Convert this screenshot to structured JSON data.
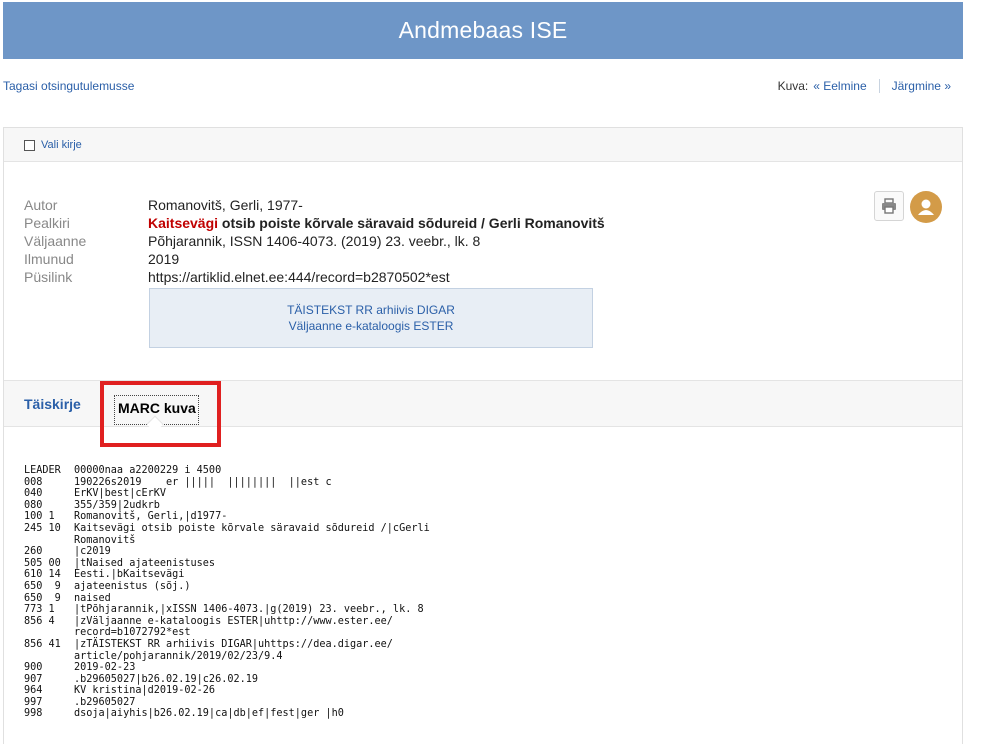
{
  "header": {
    "title": "Andmebaas ISE"
  },
  "nav": {
    "back_label": "Tagasi otsingutulemusse",
    "view_label": "Kuva:",
    "prev_label": "« Eelmine",
    "next_label": "Järgmine »"
  },
  "select": {
    "label": "Vali kirje"
  },
  "record": {
    "author_key": "Autor",
    "author_value": "Romanovitš, Gerli, 1977-",
    "title_key": "Pealkiri",
    "title_highlight": "Kaitsevägi",
    "title_rest": " otsib poiste kõrvale säravaid sõdureid / Gerli Romanovitš",
    "source_key": "Väljaanne",
    "source_value": "Põhjarannik, ISSN 1406-4073. (2019) 23. veebr., lk. 8",
    "published_key": "Ilmunud",
    "published_value": "2019",
    "permalink_key": "Püsilink",
    "permalink_value": "https://artiklid.elnet.ee:444/record=b2870502*est"
  },
  "links": {
    "fulltext": "TÄISTEKST RR arhiivis DIGAR",
    "catalog": "Väljaanne e-kataloogis ESTER"
  },
  "icons": {
    "print": "printer-icon",
    "user": "user-icon"
  },
  "tabs": {
    "full": "Täiskirje",
    "marc": "MARC kuva"
  },
  "marc": [
    {
      "tag": "LEADER",
      "text": "00000naa a2200229 i 4500"
    },
    {
      "tag": "008",
      "text": "190226s2019    er |||||  ||||||||  ||est c"
    },
    {
      "tag": "040",
      "text": "ErKV|best|cErKV"
    },
    {
      "tag": "080",
      "text": "355/359|2udkrb"
    },
    {
      "tag": "100 1",
      "text": "Romanovitš, Gerli,|d1977-"
    },
    {
      "tag": "245 10",
      "text": "Kaitsevägi otsib poiste kõrvale säravaid sõdureid /|cGerli"
    },
    {
      "tag": "",
      "text": "Romanovitš"
    },
    {
      "tag": "260",
      "text": "|c2019"
    },
    {
      "tag": "505 00",
      "text": "|tNaised ajateenistuses"
    },
    {
      "tag": "610 14",
      "text": "Eesti.|bKaitsevägi"
    },
    {
      "tag": "650  9",
      "text": "ajateenistus (sõj.)"
    },
    {
      "tag": "650  9",
      "text": "naised"
    },
    {
      "tag": "773 1",
      "text": "|tPõhjarannik,|xISSN 1406-4073.|g(2019) 23. veebr., lk. 8"
    },
    {
      "tag": "856 4",
      "text": "|zVäljaanne e-kataloogis ESTER|uhttp://www.ester.ee/"
    },
    {
      "tag": "",
      "text": "record=b1072792*est"
    },
    {
      "tag": "856 41",
      "text": "|zTÄISTEKST RR arhiivis DIGAR|uhttps://dea.digar.ee/"
    },
    {
      "tag": "",
      "text": "article/pohjarannik/2019/02/23/9.4"
    },
    {
      "tag": "900",
      "text": "2019-02-23"
    },
    {
      "tag": "907",
      "text": ".b29605027|b26.02.19|c26.02.19"
    },
    {
      "tag": "964",
      "text": "KV kristina|d2019-02-26"
    },
    {
      "tag": "997",
      "text": ".b29605027"
    },
    {
      "tag": "998",
      "text": "dsoja|aiyhis|b26.02.19|ca|db|ef|fest|ger |h0"
    }
  ]
}
